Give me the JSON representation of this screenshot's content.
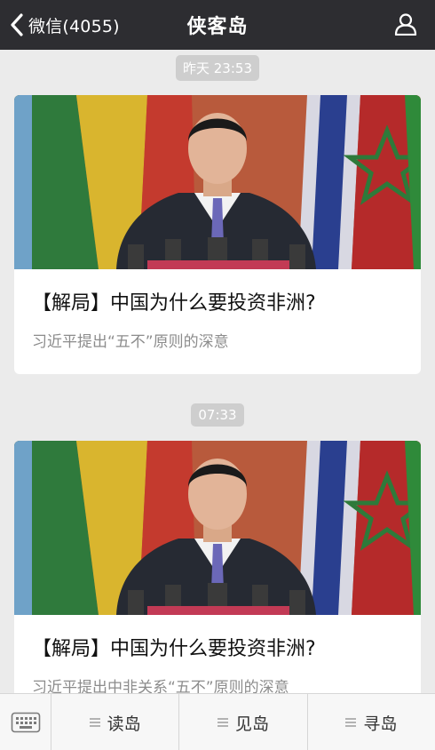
{
  "header": {
    "back_label": "微信(4055)",
    "title": "侠客岛",
    "back_icon": "chevron-left-icon",
    "profile_icon": "person-icon"
  },
  "feed": {
    "items": [
      {
        "time": "昨天 23:53",
        "title": "【解局】中国为什么要投资非洲?",
        "subtitle": "习近平提出“五不”原则的深意"
      },
      {
        "time": "07:33",
        "title": "【解局】中国为什么要投资非洲?",
        "subtitle": "习近平提出中非关系“五不”原则的深意"
      }
    ]
  },
  "bottom_bar": {
    "keyboard_icon": "keyboard-icon",
    "menus": [
      {
        "label": "读岛",
        "icon": "menu-icon"
      },
      {
        "label": "见岛",
        "icon": "menu-icon"
      },
      {
        "label": "寻岛",
        "icon": "menu-icon"
      }
    ]
  },
  "colors": {
    "header_bg": "#2d2d31",
    "page_bg": "#ebebeb",
    "badge_bg": "#cecece"
  }
}
